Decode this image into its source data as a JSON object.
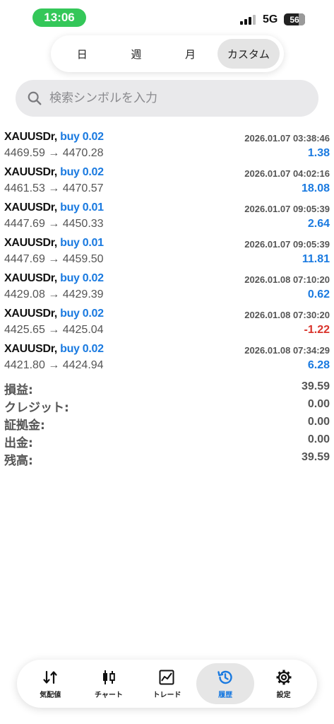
{
  "status_bar": {
    "time": "13:06",
    "network": "5G",
    "battery": "56"
  },
  "period_tabs": [
    {
      "label": "日",
      "active": false
    },
    {
      "label": "週",
      "active": false
    },
    {
      "label": "月",
      "active": false
    },
    {
      "label": "カスタム",
      "active": true
    }
  ],
  "search": {
    "placeholder": "検索シンボルを入力"
  },
  "trades": [
    {
      "symbol": "XAUUSDr,",
      "side": "buy 0.02",
      "time": "2026.01.07 03:38:46",
      "prices": "4469.59 → 4470.28",
      "profit": "1.38",
      "negative": false
    },
    {
      "symbol": "XAUUSDr,",
      "side": "buy 0.02",
      "time": "2026.01.07 04:02:16",
      "prices": "4461.53 → 4470.57",
      "profit": "18.08",
      "negative": false
    },
    {
      "symbol": "XAUUSDr,",
      "side": "buy 0.01",
      "time": "2026.01.07 09:05:39",
      "prices": "4447.69 → 4450.33",
      "profit": "2.64",
      "negative": false
    },
    {
      "symbol": "XAUUSDr,",
      "side": "buy 0.01",
      "time": "2026.01.07 09:05:39",
      "prices": "4447.69 → 4459.50",
      "profit": "11.81",
      "negative": false
    },
    {
      "symbol": "XAUUSDr,",
      "side": "buy 0.02",
      "time": "2026.01.08 07:10:20",
      "prices": "4429.08 → 4429.39",
      "profit": "0.62",
      "negative": false
    },
    {
      "symbol": "XAUUSDr,",
      "side": "buy 0.02",
      "time": "2026.01.08 07:30:20",
      "prices": "4425.65 → 4425.04",
      "profit": "-1.22",
      "negative": true
    },
    {
      "symbol": "XAUUSDr,",
      "side": "buy 0.02",
      "time": "2026.01.08 07:34:29",
      "prices": "4421.80 → 4424.94",
      "profit": "6.28",
      "negative": false
    }
  ],
  "summary": [
    {
      "label": "損益:",
      "value": "39.59"
    },
    {
      "label": "クレジット:",
      "value": "0.00"
    },
    {
      "label": "証拠金:",
      "value": "0.00"
    },
    {
      "label": "出金:",
      "value": "0.00"
    },
    {
      "label": "残高:",
      "value": "39.59"
    }
  ],
  "tab_bar": [
    {
      "label": "気配値",
      "icon": "quotes-arrows-icon",
      "active": false
    },
    {
      "label": "チャート",
      "icon": "candlestick-chart-icon",
      "active": false
    },
    {
      "label": "トレード",
      "icon": "trade-line-chart-icon",
      "active": false
    },
    {
      "label": "履歴",
      "icon": "history-clock-icon",
      "active": true
    },
    {
      "label": "設定",
      "icon": "settings-gear-icon",
      "active": false
    }
  ],
  "colors": {
    "accent": "#1a7ae0",
    "negative": "#d9332b",
    "status_pill": "#34c759"
  }
}
